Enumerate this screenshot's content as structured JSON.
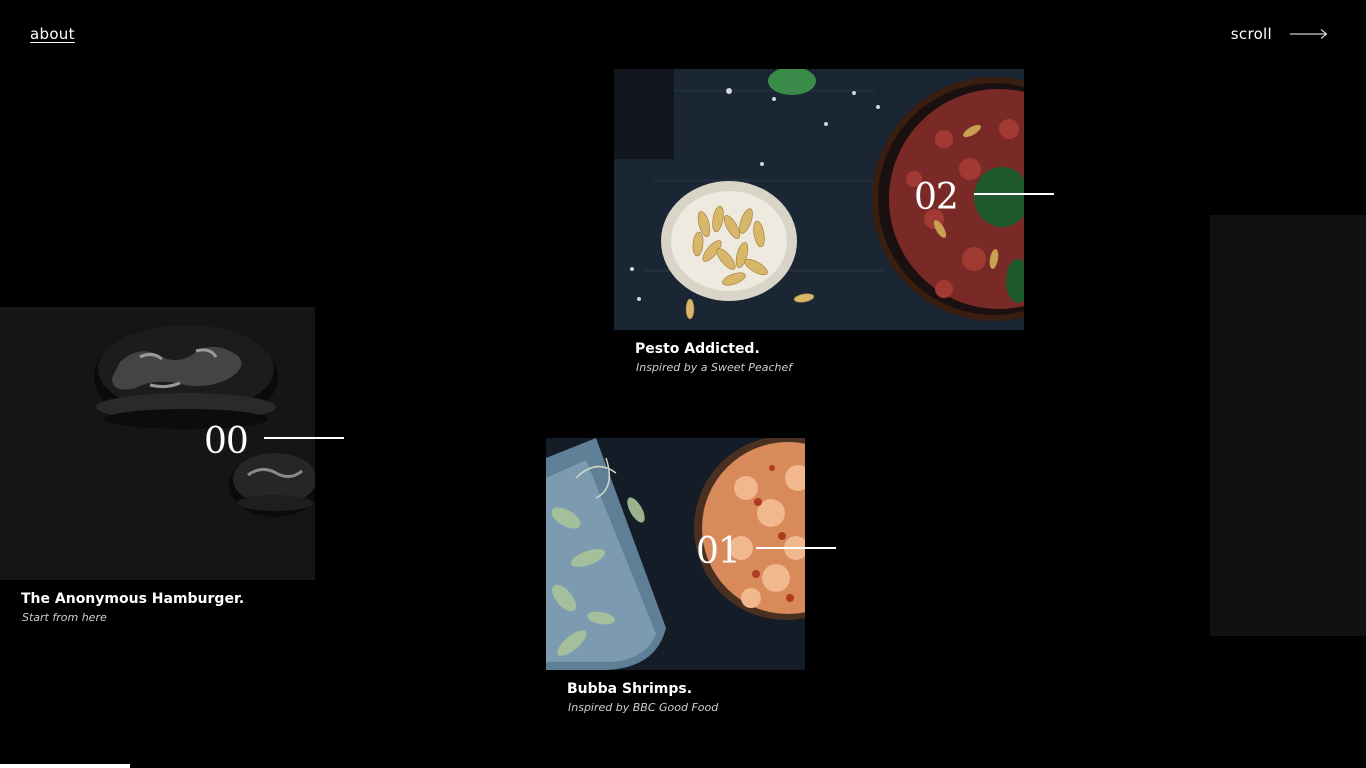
{
  "nav": {
    "about_label": "about",
    "scroll_label": "scroll"
  },
  "cards": [
    {
      "number": "00",
      "title": "The Anonymous Hamburger.",
      "subtitle": "Start from here",
      "image": "hamburger-photo"
    },
    {
      "number": "01",
      "title": "Bubba Shrimps.",
      "subtitle": "Inspired by BBC Good Food",
      "image": "shrimps-photo"
    },
    {
      "number": "02",
      "title": "Pesto Addicted.",
      "subtitle": "Inspired by a Sweet Peachef",
      "image": "pesto-photo"
    }
  ],
  "progress": {
    "fraction": 0.095
  },
  "colors": {
    "background": "#000000",
    "panel": "#111111",
    "text": "#ffffff"
  }
}
